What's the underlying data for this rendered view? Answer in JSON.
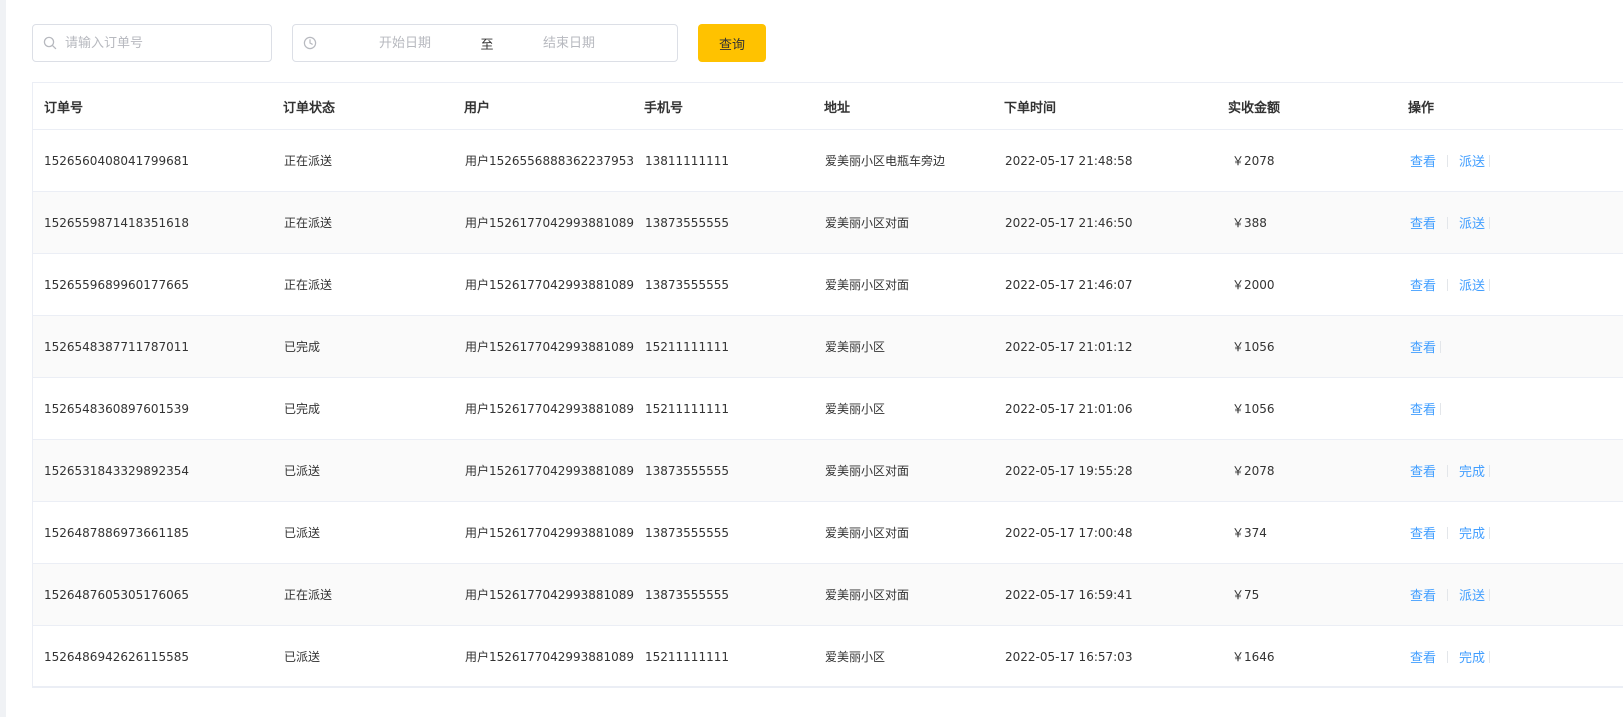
{
  "search": {
    "placeholder": "请输入订单号"
  },
  "date_range": {
    "start_placeholder": "开始日期",
    "separator": "至",
    "end_placeholder": "结束日期"
  },
  "query_button": {
    "label": "查询"
  },
  "table": {
    "headers": [
      "订单号",
      "订单状态",
      "用户",
      "手机号",
      "地址",
      "下单时间",
      "实收金额",
      "操作"
    ],
    "rows": [
      {
        "order_id": "1526560408041799681",
        "status": "正在派送",
        "user": "用户1526556888362237953",
        "phone": "13811111111",
        "address": "爱美丽小区电瓶车旁边",
        "time": "2022-05-17 21:48:58",
        "amount": "￥2078",
        "actions": [
          "查看",
          "派送"
        ]
      },
      {
        "order_id": "1526559871418351618",
        "status": "正在派送",
        "user": "用户1526177042993881089",
        "phone": "13873555555",
        "address": "爱美丽小区对面",
        "time": "2022-05-17 21:46:50",
        "amount": "￥388",
        "actions": [
          "查看",
          "派送"
        ]
      },
      {
        "order_id": "1526559689960177665",
        "status": "正在派送",
        "user": "用户1526177042993881089",
        "phone": "13873555555",
        "address": "爱美丽小区对面",
        "time": "2022-05-17 21:46:07",
        "amount": "￥2000",
        "actions": [
          "查看",
          "派送"
        ]
      },
      {
        "order_id": "1526548387711787011",
        "status": "已完成",
        "user": "用户1526177042993881089",
        "phone": "15211111111",
        "address": "爱美丽小区",
        "time": "2022-05-17 21:01:12",
        "amount": "￥1056",
        "actions": [
          "查看"
        ]
      },
      {
        "order_id": "1526548360897601539",
        "status": "已完成",
        "user": "用户1526177042993881089",
        "phone": "15211111111",
        "address": "爱美丽小区",
        "time": "2022-05-17 21:01:06",
        "amount": "￥1056",
        "actions": [
          "查看"
        ]
      },
      {
        "order_id": "1526531843329892354",
        "status": "已派送",
        "user": "用户1526177042993881089",
        "phone": "13873555555",
        "address": "爱美丽小区对面",
        "time": "2022-05-17 19:55:28",
        "amount": "￥2078",
        "actions": [
          "查看",
          "完成"
        ]
      },
      {
        "order_id": "1526487886973661185",
        "status": "已派送",
        "user": "用户1526177042993881089",
        "phone": "13873555555",
        "address": "爱美丽小区对面",
        "time": "2022-05-17 17:00:48",
        "amount": "￥374",
        "actions": [
          "查看",
          "完成"
        ]
      },
      {
        "order_id": "1526487605305176065",
        "status": "正在派送",
        "user": "用户1526177042993881089",
        "phone": "13873555555",
        "address": "爱美丽小区对面",
        "time": "2022-05-17 16:59:41",
        "amount": "￥75",
        "actions": [
          "查看",
          "派送"
        ]
      },
      {
        "order_id": "1526486942626115585",
        "status": "已派送",
        "user": "用户1526177042993881089",
        "phone": "15211111111",
        "address": "爱美丽小区",
        "time": "2022-05-17 16:57:03",
        "amount": "￥1646",
        "actions": [
          "查看",
          "完成"
        ]
      }
    ]
  },
  "icons": {
    "search": "search-icon",
    "clock": "clock-icon"
  },
  "colors": {
    "accent": "#ffc200",
    "link": "#419eff",
    "border": "#dcdfe6",
    "stripe": "#fafafa"
  }
}
